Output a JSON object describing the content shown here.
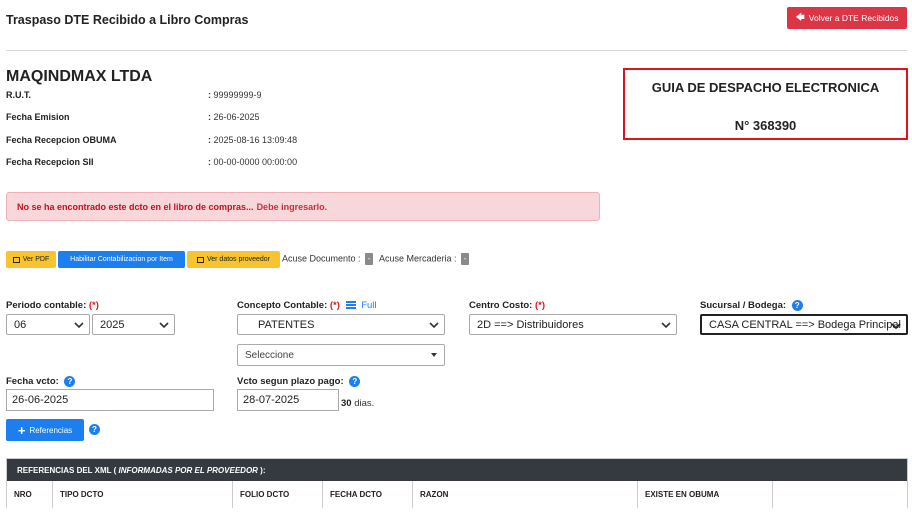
{
  "header": {
    "title": "Traspaso DTE Recibido a Libro Compras",
    "back_button": "Volver a DTE Recibidos"
  },
  "document": {
    "company": "MAQINDMAX LTDA",
    "fields": [
      {
        "label": "R.U.T.",
        "value": "99999999-9"
      },
      {
        "label": "Fecha Emision",
        "value": "26-06-2025"
      },
      {
        "label": "Fecha Recepcion OBUMA",
        "value": "2025-08-16 13:09:48"
      },
      {
        "label": "Fecha Recepcion SII",
        "value": "00-00-0000 00:00:00"
      }
    ],
    "type": "GUIA DE DESPACHO ELECTRONICA",
    "number": "N° 368390"
  },
  "alert": {
    "main": "No se ha encontrado este dcto en el libro de compras...",
    "action": "Debe ingresarlo."
  },
  "toolbar": {
    "ver_pdf": "Ver PDF",
    "habilitar": "Habilitar Contabilizacion por Item",
    "ver_proveedor": "Ver datos proveedor",
    "acuse_documento": "Acuse Documento :",
    "acuse_documento_value": "-",
    "acuse_mercaderia": "Acuse Mercaderia :",
    "acuse_mercaderia_value": "-"
  },
  "form": {
    "periodo_label": "Periodo contable:",
    "required_mark": "(*)",
    "periodo_month": "06",
    "periodo_year": "2025",
    "concepto_label": "Concepto Contable:",
    "concepto_full": "Full",
    "concepto_value": "PATENTES",
    "concepto_sub": "Seleccione",
    "centro_label": "Centro Costo:",
    "centro_value": "2D ==> Distribuidores",
    "sucursal_label": "Sucursal / Bodega:",
    "sucursal_value": "CASA CENTRAL ==> Bodega Principal",
    "fecha_vcto_label": "Fecha vcto:",
    "fecha_vcto_value": "26-06-2025",
    "vcto_plazo_label": "Vcto segun plazo pago:",
    "vcto_plazo_value": "28-07-2025",
    "dias_number": "30",
    "dias_text": "dias.",
    "referencias_button": "Referencias"
  },
  "references_table": {
    "title_main": "REFERENCIAS DEL XML (",
    "title_italic": "INFORMADAS POR EL PROVEEDOR",
    "title_end": "):",
    "columns": [
      "NRO",
      "TIPO DCTO",
      "FOLIO DCTO",
      "FECHA DCTO",
      "RAZON",
      "EXISTE EN OBUMA",
      ""
    ]
  },
  "colors": {
    "danger": "#dc3545",
    "primary": "#1d7ef0",
    "warning": "#f7c32e",
    "table_header": "#343a40",
    "highlight_border": "#e0141e"
  }
}
